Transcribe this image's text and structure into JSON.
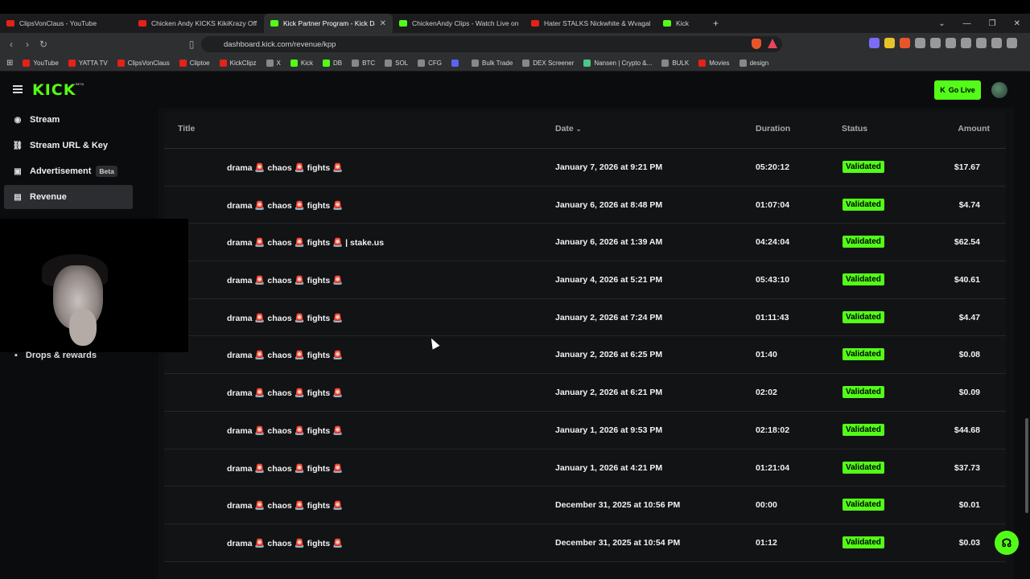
{
  "browser": {
    "tabs": [
      {
        "label": "ClipsVonClaus - YouTube",
        "favicon": "youtube-icon",
        "active": false
      },
      {
        "label": "Chicken Andy KICKS KikiKrazy Off Th",
        "favicon": "youtube-icon",
        "active": false
      },
      {
        "label": "Kick Partner Program - Kick Dast",
        "favicon": "kick-icon",
        "active": true
      },
      {
        "label": "ChickenAndy Clips - Watch Live on K",
        "favicon": "kick-icon",
        "active": false
      },
      {
        "label": "Hater STALKS Nickwhite & Wvagabo",
        "favicon": "youtube-icon",
        "active": false
      },
      {
        "label": "Kick",
        "favicon": "kick-icon",
        "active": false
      }
    ],
    "url": "dashboard.kick.com/revenue/kpp",
    "bookmarks": [
      "YouTube",
      "YATTA TV",
      "ClipsVonClaus",
      "Cliptoe",
      "KickClipz",
      "X",
      "Kick",
      "DB",
      "BTC",
      "SOL",
      "CFG",
      "",
      "Bulk Trade",
      "DEX Screener",
      "Nansen | Crypto &...",
      "BULK",
      "Movies",
      "design"
    ]
  },
  "header": {
    "logo": "KICK",
    "logo_beta": "BETA",
    "go_live": "Go Live"
  },
  "sidebar": {
    "items": [
      {
        "label": "Stream",
        "icon": "signal-icon"
      },
      {
        "label": "Stream URL & Key",
        "icon": "link-icon"
      },
      {
        "label": "Advertisement",
        "icon": "ad-icon",
        "badge": "Beta"
      },
      {
        "label": "Revenue",
        "icon": "chart-icon",
        "active": true
      }
    ],
    "drops_label": "Drops & rewards"
  },
  "table": {
    "columns": {
      "title": "Title",
      "date": "Date",
      "duration": "Duration",
      "status": "Status",
      "amount": "Amount"
    },
    "rows": [
      {
        "title": "drama 🚨 chaos 🚨 fights 🚨",
        "date": "January 7, 2026 at 9:21 PM",
        "duration": "05:20:12",
        "status": "Validated",
        "amount": "$17.67"
      },
      {
        "title": "drama 🚨 chaos 🚨 fights 🚨",
        "date": "January 6, 2026 at 8:48 PM",
        "duration": "01:07:04",
        "status": "Validated",
        "amount": "$4.74"
      },
      {
        "title": "drama 🚨 chaos 🚨 fights 🚨 | stake.us",
        "date": "January 6, 2026 at 1:39 AM",
        "duration": "04:24:04",
        "status": "Validated",
        "amount": "$62.54"
      },
      {
        "title": "drama 🚨 chaos 🚨 fights 🚨",
        "date": "January 4, 2026 at 5:21 PM",
        "duration": "05:43:10",
        "status": "Validated",
        "amount": "$40.61"
      },
      {
        "title": "drama 🚨 chaos 🚨 fights 🚨",
        "date": "January 2, 2026 at 7:24 PM",
        "duration": "01:11:43",
        "status": "Validated",
        "amount": "$4.47"
      },
      {
        "title": "drama 🚨 chaos 🚨 fights 🚨",
        "date": "January 2, 2026 at 6:25 PM",
        "duration": "01:40",
        "status": "Validated",
        "amount": "$0.08"
      },
      {
        "title": "drama 🚨 chaos 🚨 fights 🚨",
        "date": "January 2, 2026 at 6:21 PM",
        "duration": "02:02",
        "status": "Validated",
        "amount": "$0.09"
      },
      {
        "title": "drama 🚨 chaos 🚨 fights 🚨",
        "date": "January 1, 2026 at 9:53 PM",
        "duration": "02:18:02",
        "status": "Validated",
        "amount": "$44.68"
      },
      {
        "title": "drama 🚨 chaos 🚨 fights 🚨",
        "date": "January 1, 2026 at 4:21 PM",
        "duration": "01:21:04",
        "status": "Validated",
        "amount": "$37.73"
      },
      {
        "title": "drama 🚨 chaos 🚨 fights 🚨",
        "date": "December 31, 2025 at 10:56 PM",
        "duration": "00:00",
        "status": "Validated",
        "amount": "$0.01"
      },
      {
        "title": "drama 🚨 chaos 🚨 fights 🚨",
        "date": "December 31, 2025 at 10:54 PM",
        "duration": "01:12",
        "status": "Validated",
        "amount": "$0.03"
      }
    ]
  },
  "colors": {
    "accent": "#53fc18",
    "background": "#0b0c0d",
    "table_bg": "#121315"
  }
}
